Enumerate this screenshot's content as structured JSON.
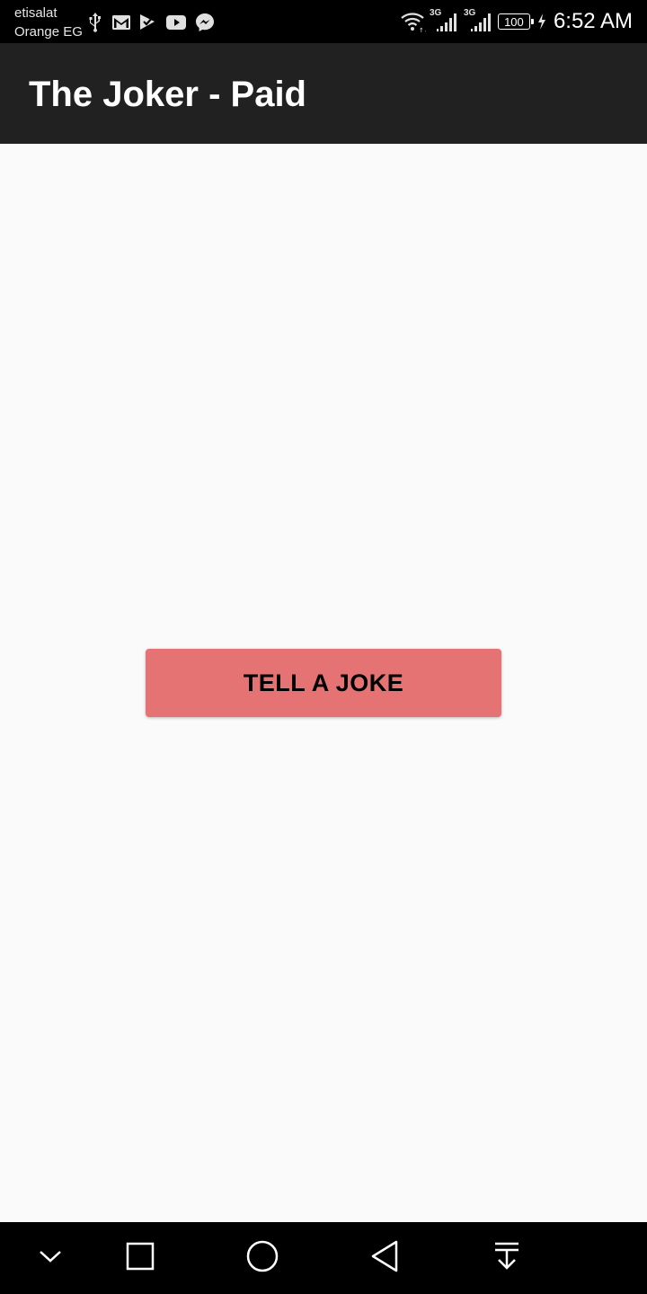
{
  "status_bar": {
    "carrier_line1": "etisalat",
    "carrier_line2": "Orange EG",
    "network_type_1": "3G",
    "network_type_2": "3G",
    "battery_level": "100",
    "time": "6:52 AM",
    "notification_icons": [
      "usb-icon",
      "gmail-icon",
      "check-play-icon",
      "youtube-icon",
      "messenger-icon"
    ],
    "system_icons": [
      "wifi-icon",
      "signal-icon",
      "signal-icon",
      "battery-icon",
      "charging-icon"
    ]
  },
  "app_bar": {
    "title": "The Joker - Paid",
    "background_color": "#212121"
  },
  "main": {
    "tell_joke_button_label": "TELL A JOKE",
    "button_color": "#e57373"
  },
  "nav_bar": {
    "buttons": [
      "collapse-icon",
      "recents-icon",
      "home-icon",
      "back-icon",
      "notifications-pull-icon"
    ]
  }
}
